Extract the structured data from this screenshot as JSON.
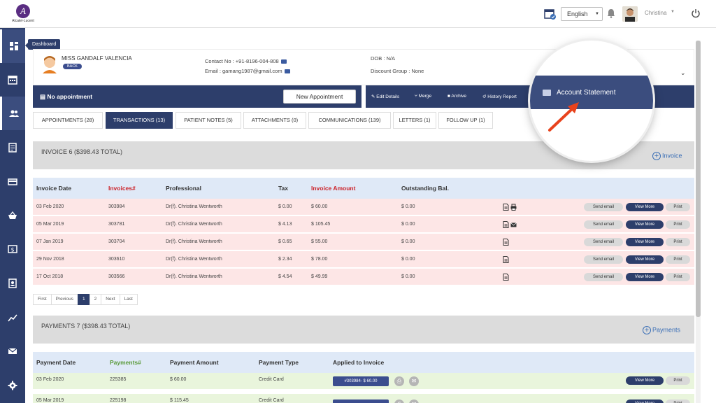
{
  "app": {
    "logo_text": "Alcatel-Lucent",
    "logo_letter": "A",
    "language": "English",
    "user_name": "Christina"
  },
  "sidebar": {
    "tooltip": "Dashboard",
    "items": [
      "dashboard",
      "calendar",
      "patients",
      "notes",
      "billing",
      "products",
      "payments",
      "contacts",
      "reports",
      "messages",
      "settings"
    ]
  },
  "patient": {
    "name": "MISS GANDALF VALENCIA",
    "back_label": "BACK",
    "contact": "Contact No : +91-8196-004-808",
    "email": "Email : gamang1987@gmail.com",
    "dob": "DOB : N/A",
    "discount_group": "Discount Group : None"
  },
  "actions": {
    "no_appointment": "No appointment",
    "new_appointment": "New Appointment",
    "edit_details": "Edit Details",
    "merge": "Merge",
    "archive": "Archive",
    "history_report": "History Report",
    "account_statement": "Account Statement"
  },
  "tabs": [
    {
      "label": "APPOINTMENTS (28)",
      "active": false
    },
    {
      "label": "TRANSACTIONS (13)",
      "active": true
    },
    {
      "label": "PATIENT NOTES (5)",
      "active": false
    },
    {
      "label": "ATTACHMENTS (0)",
      "active": false
    },
    {
      "label": "COMMUNICATIONS (139)",
      "active": false
    },
    {
      "label": "LETTERS (1)",
      "active": false
    },
    {
      "label": "FOLLOW UP (1)",
      "active": false
    }
  ],
  "invoices": {
    "title": "INVOICE 6   ($398.43 TOTAL)",
    "add_label": "Invoice",
    "headers": {
      "date": "Invoice Date",
      "number": "Invoices#",
      "professional": "Professional",
      "tax": "Tax",
      "amount": "Invoice Amount",
      "outstanding": "Outstanding Bal."
    },
    "rows": [
      {
        "date": "03 Feb 2020",
        "number": "303984",
        "professional": "Dr(f). Christina Wentworth",
        "tax": "$ 0.00",
        "amount": "$ 60.00",
        "outstanding": "$ 0.00",
        "icons": [
          "document-icon",
          "printer-icon"
        ]
      },
      {
        "date": "05 Mar 2019",
        "number": "303781",
        "professional": "Dr(f). Christina Wentworth",
        "tax": "$ 4.13",
        "amount": "$ 105.45",
        "outstanding": "$ 0.00",
        "icons": [
          "document-icon",
          "envelope-icon"
        ]
      },
      {
        "date": "07 Jan 2019",
        "number": "303704",
        "professional": "Dr(f). Christina Wentworth",
        "tax": "$ 0.65",
        "amount": "$ 55.00",
        "outstanding": "$ 0.00",
        "icons": [
          "document-icon"
        ]
      },
      {
        "date": "29 Nov 2018",
        "number": "303610",
        "professional": "Dr(f). Christina Wentworth",
        "tax": "$ 2.34",
        "amount": "$ 78.00",
        "outstanding": "$ 0.00",
        "icons": [
          "document-icon"
        ]
      },
      {
        "date": "17 Oct 2018",
        "number": "303566",
        "professional": "Dr(f). Christina Wentworth",
        "tax": "$ 4.54",
        "amount": "$ 49.99",
        "outstanding": "$ 0.00",
        "icons": [
          "document-icon"
        ]
      }
    ],
    "row_buttons": {
      "send": "Send email",
      "view": "View More",
      "print": "Print"
    }
  },
  "pagination": [
    "First",
    "Previous",
    "1",
    "2",
    "Next",
    "Last"
  ],
  "pagination_active": "1",
  "payments": {
    "title": "PAYMENTS  7 ($398.43 TOTAL)",
    "add_label": "Payments",
    "headers": {
      "date": "Payment Date",
      "number": "Payments#",
      "amount": "Payment Amount",
      "type": "Payment Type",
      "applied": "Applied to Invoice"
    },
    "rows": [
      {
        "date": "03 Feb 2020",
        "number": "225385",
        "amount": "$ 60.00",
        "type": "Credit Card",
        "applied": "#303984- $ 60.00"
      },
      {
        "date": "05 Mar 2019",
        "number": "225198",
        "amount": "$ 115.45",
        "type": "Credit Card",
        "applied": ""
      }
    ],
    "row_buttons": {
      "view": "View More",
      "print": "Print"
    }
  }
}
